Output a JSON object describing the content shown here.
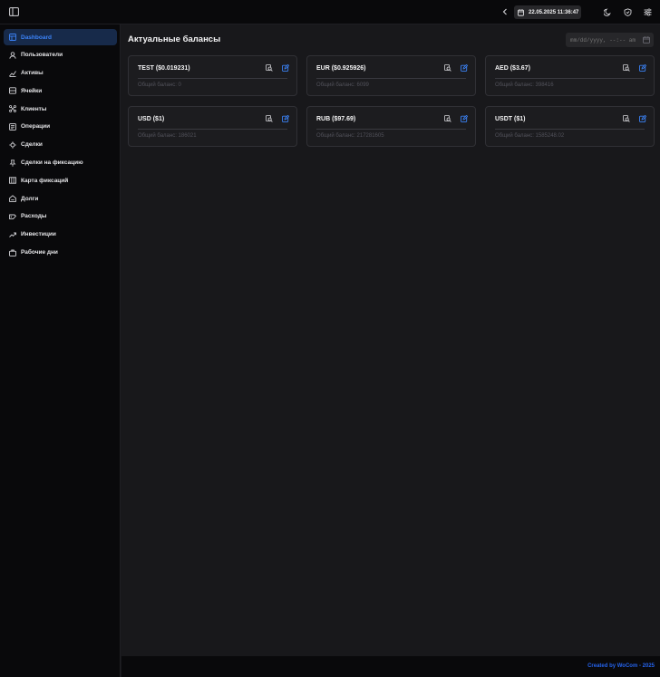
{
  "topbar": {
    "datetime": "22.05.2025 11:36:47",
    "icons": [
      "sidebar-toggle-icon",
      "chevron-left-icon",
      "calendar-clock-icon",
      "moon-icon",
      "shield-icon",
      "settings-sliders-icon"
    ]
  },
  "sidebar": {
    "items": [
      {
        "label": "Dashboard",
        "icon": "dashboard-icon",
        "active": true
      },
      {
        "label": "Пользователи",
        "icon": "user-icon"
      },
      {
        "label": "Активы",
        "icon": "chart-line-icon"
      },
      {
        "label": "Ячейки",
        "icon": "cells-icon"
      },
      {
        "label": "Клиенты",
        "icon": "clients-icon"
      },
      {
        "label": "Операции",
        "icon": "operations-icon"
      },
      {
        "label": "Сделки",
        "icon": "deals-icon"
      },
      {
        "label": "Сделки на фиксацию",
        "icon": "pin-icon"
      },
      {
        "label": "Карта фиксаций",
        "icon": "map-icon"
      },
      {
        "label": "Долги",
        "icon": "debts-icon"
      },
      {
        "label": "Расходы",
        "icon": "expenses-icon"
      },
      {
        "label": "Инвестиции",
        "icon": "investments-icon"
      },
      {
        "label": "Рабочие дни",
        "icon": "workdays-icon"
      }
    ]
  },
  "main": {
    "title": "Актуальные балансы",
    "date_filter_placeholder": "mm/dd/yyyy, --:-- am",
    "cards": [
      {
        "title": "TEST ($0.019231)",
        "balance": "Общий баланс: 0"
      },
      {
        "title": "EUR ($0.925926)",
        "balance": "Общий баланс: 6099"
      },
      {
        "title": "AED ($3.67)",
        "balance": "Общий баланс: 398416"
      },
      {
        "title": "USD ($1)",
        "balance": "Общий баланс: 186021"
      },
      {
        "title": "RUB ($97.69)",
        "balance": "Общий баланс: 217281605"
      },
      {
        "title": "USDT ($1)",
        "balance": "Общий баланс: 1585248.02"
      }
    ]
  },
  "footer": {
    "text": "Created by WoCom - 2025"
  },
  "colors": {
    "accent": "#3b82f6",
    "active_bg": "#172a4a",
    "card_bg": "#1c1c1f"
  }
}
